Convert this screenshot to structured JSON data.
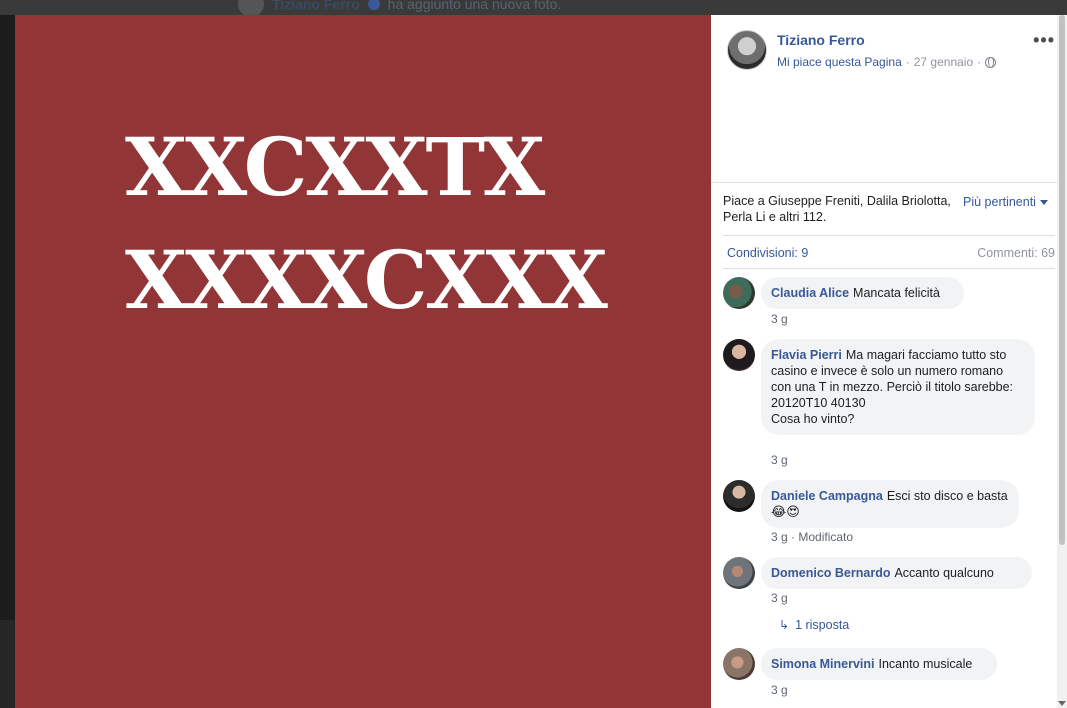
{
  "background_feed": {
    "author": "Tiziano Ferro",
    "action": "ha aggiunto una nuova foto."
  },
  "photo": {
    "line1": "XXCXXTX",
    "line2": "XXXXCXXX",
    "background_color": "#923537"
  },
  "post": {
    "page_name": "Tiziano Ferro",
    "like_page": "Mi piace questa Pagina",
    "date": "27 gennaio",
    "separator": "·",
    "more_icon": "more-options-icon",
    "privacy_icon": "globe-icon"
  },
  "reactions": {
    "likes_text": "Piace a Giuseppe Freniti, Dalila Briolotta, Perla Li e altri 112.",
    "sort_label": "Più pertinenti",
    "shares": "Condivisioni: 9",
    "comments": "Commenti: 69"
  },
  "comments": [
    {
      "name": "Claudia Alice",
      "text": "Mancata felicità",
      "time": "3 g"
    },
    {
      "name": "Flavia Pierri",
      "text": "Ma magari facciamo tutto sto casino e invece è solo un numero romano con una T in mezzo. Perciò il titolo sarebbe:\n20120T10 40130\nCosa ho vinto?",
      "time": "3 g"
    },
    {
      "name": "Daniele Campagna",
      "text": "Esci sto disco e basta",
      "emoji": "😂😍",
      "time": "3 g",
      "edited": "· Modificato"
    },
    {
      "name": "Domenico Bernardo",
      "text": "Accanto qualcuno",
      "time": "3 g",
      "replies": "1 risposta"
    },
    {
      "name": "Simona Minervini",
      "text": "Incanto musicale",
      "time": "3 g"
    }
  ],
  "colors": {
    "link": "#365899",
    "bubble": "#f2f3f5",
    "muted": "#90949c"
  }
}
